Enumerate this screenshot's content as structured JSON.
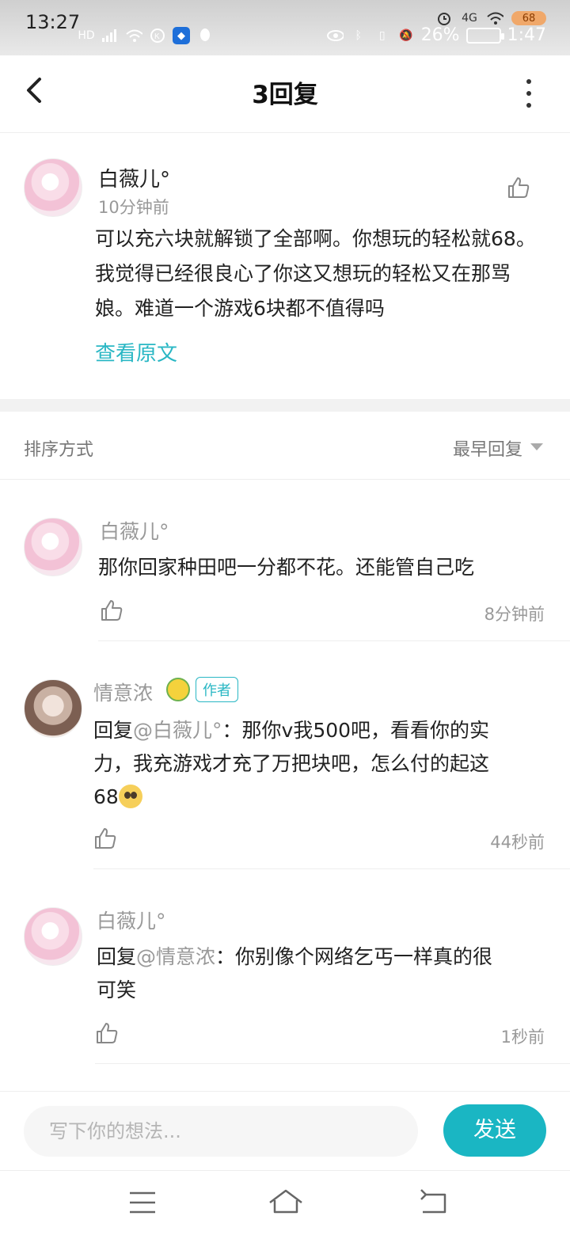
{
  "status_bar": {
    "time": "13:27",
    "battery": "26%",
    "clock": "1:47",
    "network": "4G",
    "badge": "68"
  },
  "header": {
    "title": "3回复"
  },
  "main_comment": {
    "user": "白薇儿°",
    "time": "10分钟前",
    "text": "可以充六块就解锁了全部啊。你想玩的轻松就68。我觉得已经很良心了你这又想玩的轻松又在那骂娘。难道一个游戏6块都不值得吗",
    "view_original": "查看原文"
  },
  "sort": {
    "label": "排序方式",
    "value": "最早回复"
  },
  "replies": [
    {
      "user": "白薇儿°",
      "text": "那你回家种田吧一分都不花。还能管自己吃",
      "time": "8分钟前"
    },
    {
      "user": "情意浓",
      "badge": "作者",
      "prefix": "回复",
      "mention": "@白薇儿°",
      "text_line1": "：那你v我500吧，看看你的实",
      "text_line2": "力，我充游戏才充了万把块吧，怎么付的起这",
      "text_line3": "68",
      "time": "44秒前"
    },
    {
      "user": "白薇儿°",
      "prefix": "回复",
      "mention": "@情意浓",
      "text_line1": "：你别像个网络乞丐一样真的很",
      "text_line2": "可笑",
      "time": "1秒前"
    }
  ],
  "input": {
    "placeholder": "写下你的想法...",
    "send_label": "发送"
  }
}
